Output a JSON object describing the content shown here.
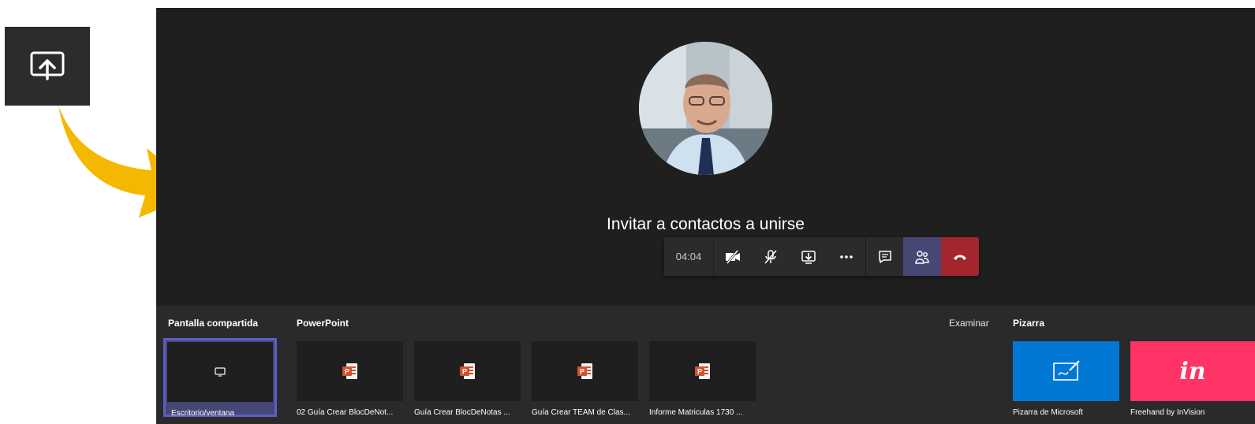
{
  "callout": {
    "icon": "share-screen-icon"
  },
  "stage": {
    "avatar_icon": "participant-photo",
    "invite_text": "Invitar a contactos a unirse"
  },
  "controls": {
    "timer": "04:04",
    "items": [
      {
        "icon": "camera-off-icon"
      },
      {
        "icon": "mic-off-icon"
      },
      {
        "icon": "share-tray-icon"
      },
      {
        "icon": "more-options-icon"
      },
      {
        "icon": "chat-icon"
      },
      {
        "icon": "participants-icon"
      },
      {
        "icon": "hang-up-icon"
      }
    ],
    "colors": {
      "participants_bg": "#464775",
      "hangup_bg": "#a4262c"
    }
  },
  "tray": {
    "desktop": {
      "title": "Pantalla compartida",
      "item_label": "Escritorio/ventana",
      "icon": "monitor-icon"
    },
    "powerpoint": {
      "title": "PowerPoint",
      "browse_label": "Examinar",
      "files": [
        {
          "label": "02 Guía Crear BlocDeNot...",
          "icon": "powerpoint-icon"
        },
        {
          "label": "Guía Crear BlocDeNotas ...",
          "icon": "powerpoint-icon"
        },
        {
          "label": "Guía Crear TEAM de Clas...",
          "icon": "powerpoint-icon"
        },
        {
          "label": "Informe Matriculas 1730 ...",
          "icon": "powerpoint-icon"
        }
      ]
    },
    "whiteboard": {
      "title": "Pizarra",
      "items": [
        {
          "label": "Pizarra de Microsoft",
          "icon": "whiteboard-icon",
          "color": "#0078d4"
        },
        {
          "label": "Freehand by InVision",
          "glyph": "in",
          "color": "#ff3366"
        }
      ]
    }
  }
}
